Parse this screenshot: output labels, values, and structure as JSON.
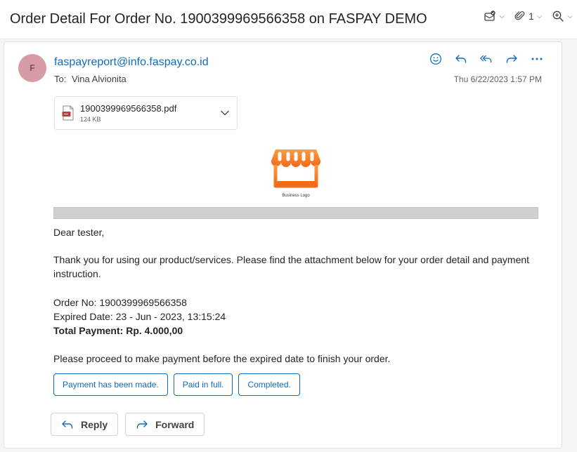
{
  "subject": "Order Detail For Order No. 1900399969566358 on FASPAY DEMO",
  "toolbar": {
    "attachment_count": "1",
    "icons": [
      "mark-read-icon",
      "paperclip-icon",
      "zoom-icon"
    ]
  },
  "message": {
    "avatar_initial": "F",
    "sender": "faspayreport@info.faspay.co.id",
    "to_label": "To:",
    "to_name": "Vina Alvionita",
    "date": "Thu 6/22/2023 1:57 PM"
  },
  "attachment": {
    "name": "1900399969566358.pdf",
    "size": "124 KB"
  },
  "logo": {
    "caption": "Business Logo",
    "color": "#f26a1b"
  },
  "body": {
    "greeting": "Dear tester,",
    "thanks": "Thank you for using our product/services. Please find the attachment below for your order detail and payment instruction.",
    "order_no": "Order No: 1900399969566358",
    "expired": "Expired Date: 23 - Jun - 2023, 13:15:24",
    "total": "Total Payment: Rp. 4.000,00",
    "proceed": "Please proceed to make payment before the expired date to finish your order."
  },
  "suggestions": [
    "Payment has been made.",
    "Paid in full.",
    "Completed."
  ],
  "reply_actions": {
    "reply": "Reply",
    "forward": "Forward"
  },
  "colors": {
    "accent": "#0f6cbd",
    "avatar_bg": "#d69ca5"
  }
}
